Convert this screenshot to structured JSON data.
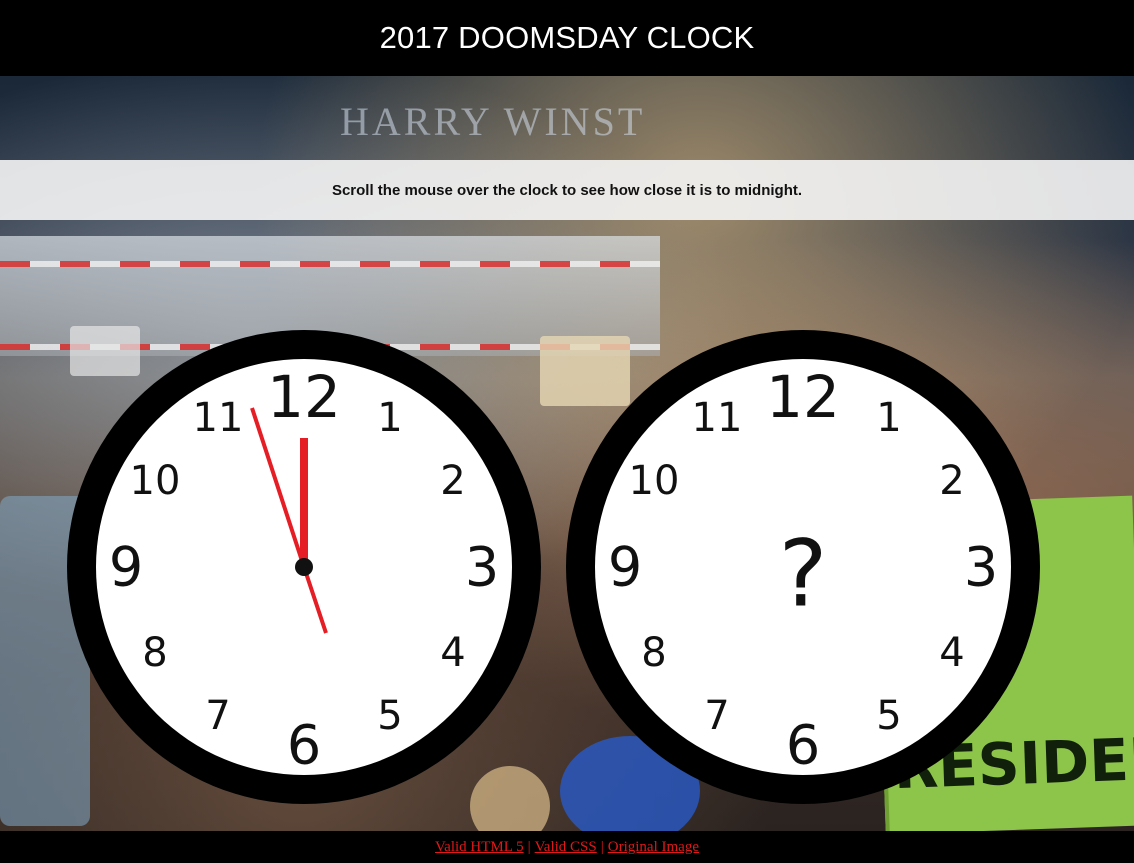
{
  "header": {
    "title": "2017 DOOMSDAY CLOCK"
  },
  "instructions": {
    "text": "Scroll the mouse over the clock to see how close it is to midnight."
  },
  "clocks": {
    "numerals": [
      "12",
      "1",
      "2",
      "3",
      "4",
      "5",
      "6",
      "7",
      "8",
      "9",
      "10",
      "11"
    ],
    "left": {
      "time_shown": "11:57:30"
    },
    "right": {
      "hidden_symbol": "?"
    }
  },
  "footer": {
    "links": [
      "Valid HTML 5",
      "Valid CSS",
      "Original Image"
    ],
    "separator": "|"
  },
  "colors": {
    "accent_red": "#e51e25",
    "clock_rim": "#000000",
    "clock_face": "#ffffff",
    "link_red": "#e01818"
  },
  "background_sign_text": "HARRY WINST"
}
